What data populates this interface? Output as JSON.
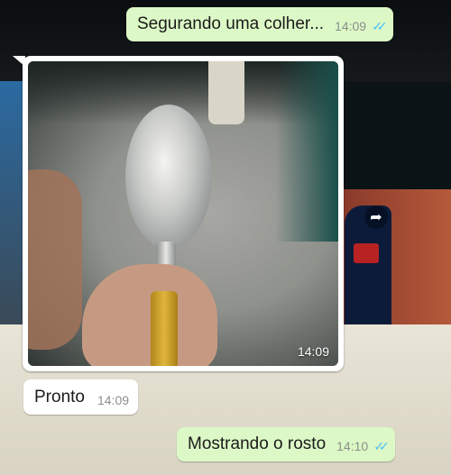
{
  "messages": [
    {
      "text": "Segurando uma colher...",
      "time": "14:09",
      "ticks": "✓✓"
    },
    {
      "image_time": "14:09"
    },
    {
      "text": "Pronto",
      "time": "14:09"
    },
    {
      "text": "Mostrando o rosto",
      "time": "14:10",
      "ticks": "✓✓"
    }
  ],
  "icons": {
    "forward": "forward-arrow-icon",
    "read_receipt": "double-check-icon"
  },
  "colors": {
    "outgoing_bubble": "#dcf8c6",
    "incoming_bubble": "#ffffff",
    "read_ticks": "#4fc3f7"
  }
}
